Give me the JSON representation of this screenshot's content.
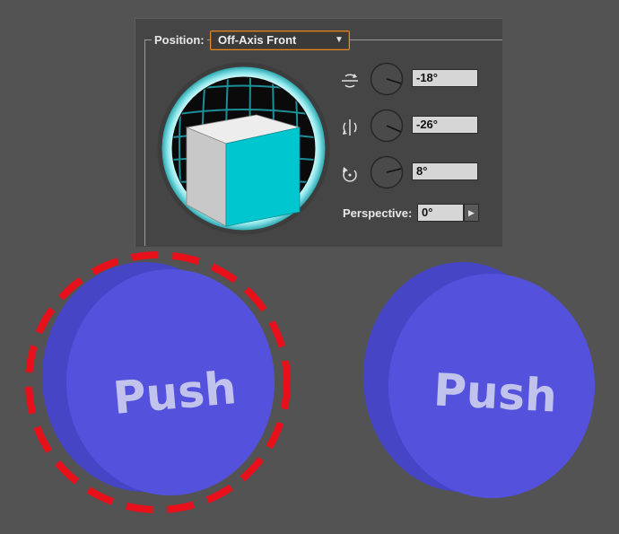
{
  "panel": {
    "position_label": "Position:",
    "position_value": "Off-Axis Front",
    "rotation_x": "-18°",
    "rotation_y": "-26°",
    "rotation_z": "8°",
    "perspective_label": "Perspective:",
    "perspective_value": "0°"
  },
  "buttons": {
    "left_label": "Push",
    "right_label": "Push"
  },
  "colors": {
    "background": "#535353",
    "panel": "#454545",
    "accent_orange": "#e08a2e",
    "button_face": "#5452dc",
    "button_side": "#4545c6",
    "button_text": "#c2c3ec",
    "highlight_red": "#e8101a",
    "cube_face": "#00c6cf"
  },
  "icons": [
    "rotate-x-icon",
    "rotate-y-icon",
    "rotate-z-icon",
    "dropdown-arrow-icon",
    "perspective-arrow-icon"
  ]
}
